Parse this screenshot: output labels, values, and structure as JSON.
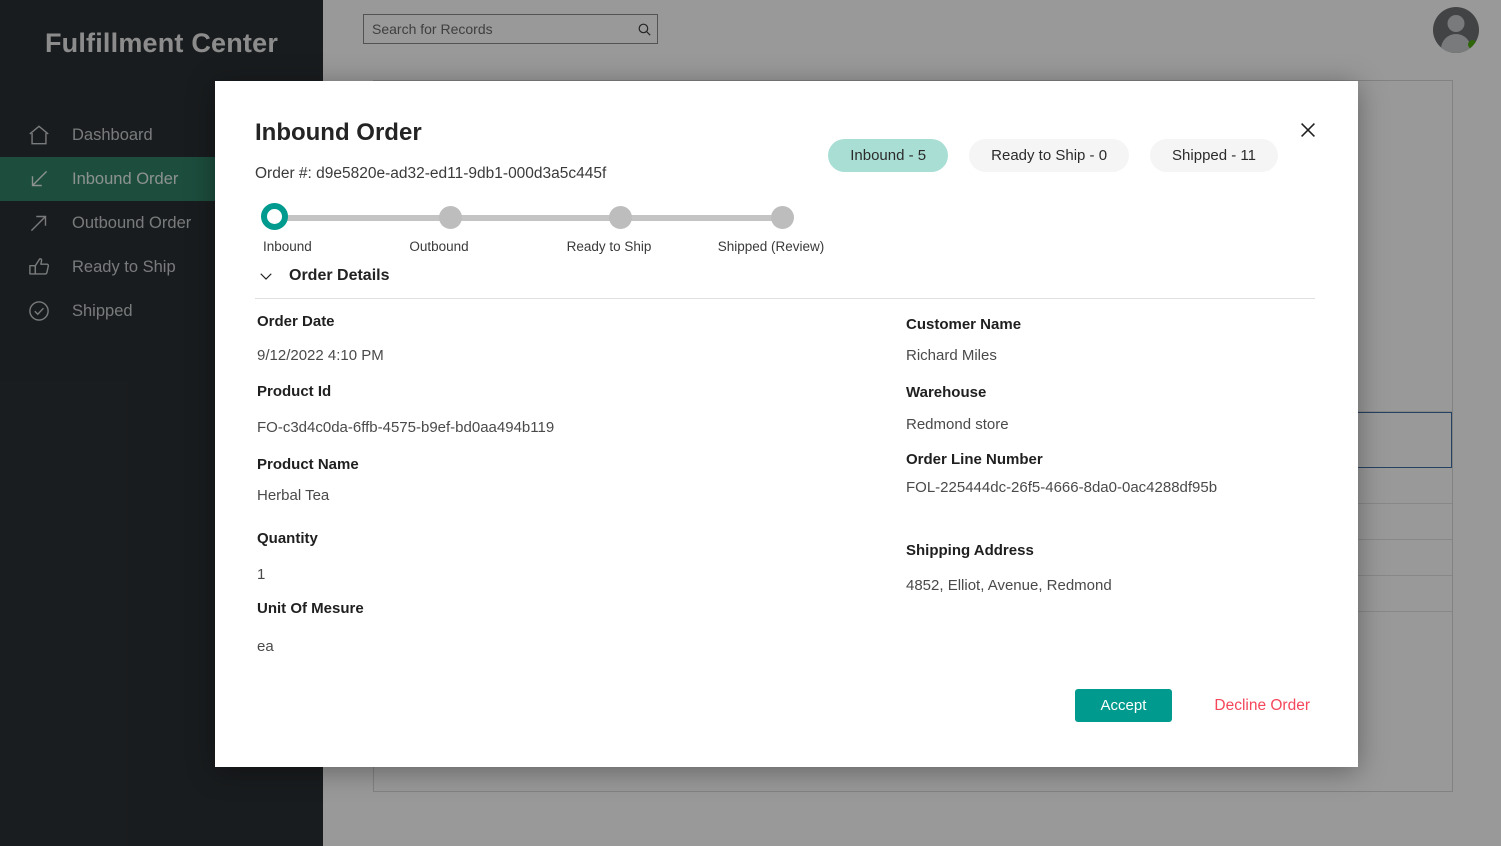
{
  "app": {
    "brand": "Fulfillment Center",
    "colors": {
      "sidebar_bg": "#2b3033",
      "sidebar_active": "#2f8166",
      "accent_teal": "#009b8e",
      "pill_active": "#a9ded4",
      "decline_red": "#f5465b",
      "status_online": "#4faa12"
    }
  },
  "topbar": {
    "search_placeholder": "Search for Records",
    "search_value": "",
    "search_icon": "search-icon",
    "avatar_icon": "avatar",
    "avatar_status": "online"
  },
  "sidebar": {
    "items": [
      {
        "label": "Dashboard",
        "icon": "home-icon",
        "active": false
      },
      {
        "label": "Inbound Order",
        "icon": "arrow-down-left-icon",
        "active": true
      },
      {
        "label": "Outbound Order",
        "icon": "arrow-up-right-icon",
        "active": false
      },
      {
        "label": "Ready to Ship",
        "icon": "thumbs-up-icon",
        "active": false
      },
      {
        "label": "Shipped",
        "icon": "check-circle-icon",
        "active": false
      }
    ]
  },
  "modal": {
    "title": "Inbound Order",
    "order_number_label": "Order #: d9e5820e-ad32-ed11-9db1-000d3a5c445f",
    "close_icon": "close-icon",
    "pills": [
      {
        "label": "Inbound - 5",
        "active": true
      },
      {
        "label": "Ready to Ship - 0",
        "active": false
      },
      {
        "label": "Shipped - 11",
        "active": false
      }
    ],
    "stepper": {
      "steps": [
        {
          "caption": "Inbound",
          "state": "current"
        },
        {
          "caption": "Outbound",
          "state": "pending"
        },
        {
          "caption": "Ready to Ship",
          "state": "pending"
        },
        {
          "caption": "Shipped (Review)",
          "state": "pending"
        }
      ]
    },
    "section": {
      "title": "Order Details",
      "expanded": true,
      "chevron_icon": "chevron-down-icon"
    },
    "fields_left": [
      {
        "label": "Order Date",
        "value": " 9/12/2022 4:10 PM"
      },
      {
        "label": "Product Id",
        "value": "FO-c3d4c0da-6ffb-4575-b9ef-bd0aa494b119"
      },
      {
        "label": "Product Name",
        "value": "Herbal Tea"
      },
      {
        "label": "Quantity",
        "value": "1"
      },
      {
        "label": "Unit Of Mesure",
        "value": "ea"
      }
    ],
    "fields_right": [
      {
        "label": "Customer Name",
        "value": " Richard Miles"
      },
      {
        "label": "Warehouse",
        "value": " Redmond store"
      },
      {
        "label": "Order Line Number",
        "value": "FOL-225444dc-26f5-4666-8da0-0ac4288df95b"
      },
      {
        "label": "Shipping Address",
        "value": " 4852, Elliot, Avenue, Redmond"
      }
    ],
    "actions": {
      "accept_label": "Accept",
      "decline_label": "Decline Order"
    }
  }
}
